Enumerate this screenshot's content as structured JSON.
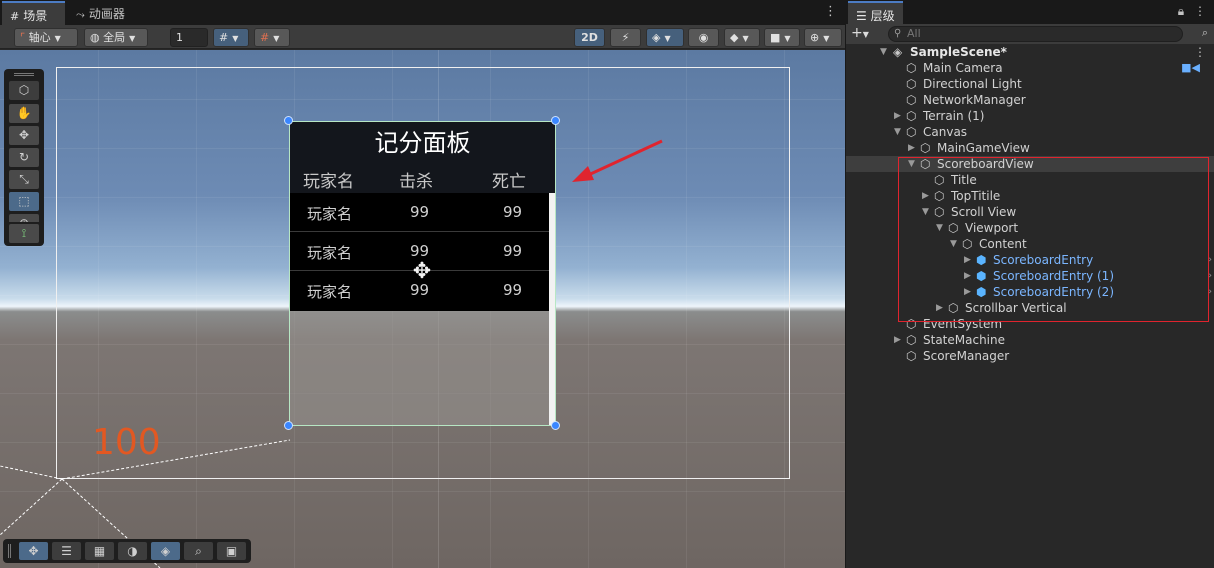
{
  "scene_tabs": [
    {
      "icon": "grid-icon",
      "label": "场景"
    },
    {
      "icon": "animator-icon",
      "label": "动画器"
    }
  ],
  "scene_toolbar": {
    "pivot_label": "轴心",
    "global_label": "全局",
    "grid_snap_value": "1",
    "mode_2d_label": "2D"
  },
  "scoreboard": {
    "title": "记分面板",
    "columns": [
      "玩家名",
      "击杀",
      "死亡"
    ],
    "rows": [
      {
        "name": "玩家名",
        "kills": "99",
        "deaths": "99"
      },
      {
        "name": "玩家名",
        "kills": "99",
        "deaths": "99"
      },
      {
        "name": "玩家名",
        "kills": "99",
        "deaths": "99"
      }
    ]
  },
  "scene_overlay": {
    "label_100": "100"
  },
  "hierarchy": {
    "tab_label": "层级",
    "search_placeholder": "All",
    "items": [
      {
        "label": "SampleScene*",
        "depth": 0,
        "expanded": true,
        "type": "scene"
      },
      {
        "label": "Main Camera",
        "depth": 1,
        "type": "object",
        "extra_icon": "camera-icon"
      },
      {
        "label": "Directional Light",
        "depth": 1,
        "type": "object"
      },
      {
        "label": "NetworkManager",
        "depth": 1,
        "type": "object"
      },
      {
        "label": "Terrain (1)",
        "depth": 1,
        "type": "object",
        "collapsed": true
      },
      {
        "label": "Canvas",
        "depth": 1,
        "type": "object",
        "expanded": true
      },
      {
        "label": "MainGameView",
        "depth": 2,
        "type": "object",
        "collapsed": true
      },
      {
        "label": "ScoreboardView",
        "depth": 2,
        "type": "object",
        "expanded": true,
        "selected": true
      },
      {
        "label": "Title",
        "depth": 3,
        "type": "object"
      },
      {
        "label": "TopTitile",
        "depth": 3,
        "type": "object",
        "collapsed": true
      },
      {
        "label": "Scroll View",
        "depth": 3,
        "type": "object",
        "expanded": true
      },
      {
        "label": "Viewport",
        "depth": 4,
        "type": "object",
        "expanded": true
      },
      {
        "label": "Content",
        "depth": 5,
        "type": "object",
        "expanded": true
      },
      {
        "label": "ScoreboardEntry",
        "depth": 6,
        "type": "prefab",
        "collapsed": true
      },
      {
        "label": "ScoreboardEntry (1)",
        "depth": 6,
        "type": "prefab",
        "collapsed": true
      },
      {
        "label": "ScoreboardEntry (2)",
        "depth": 6,
        "type": "prefab",
        "collapsed": true
      },
      {
        "label": "Scrollbar Vertical",
        "depth": 4,
        "type": "object",
        "collapsed": true
      },
      {
        "label": "EventSystem",
        "depth": 1,
        "type": "object"
      },
      {
        "label": "StateMachine",
        "depth": 1,
        "type": "object",
        "collapsed": true
      },
      {
        "label": "ScoreManager",
        "depth": 1,
        "type": "object"
      }
    ]
  },
  "colors": {
    "highlight_box": "#e0242e",
    "annotation_arrow": "#e0242e",
    "label_100": "#e25822",
    "prefab_text": "#7bb6ff"
  }
}
